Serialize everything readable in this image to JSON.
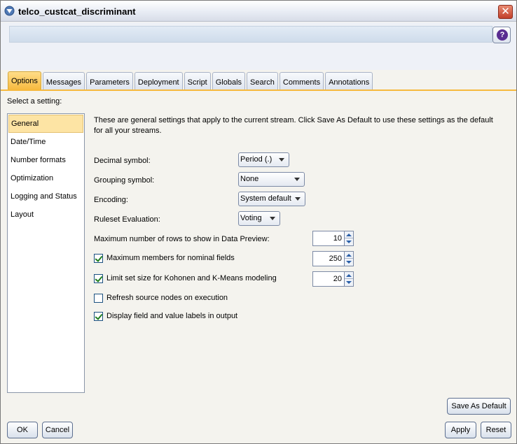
{
  "window": {
    "title": "telco_custcat_discriminant"
  },
  "tabs": [
    {
      "label": "Options",
      "active": true
    },
    {
      "label": "Messages"
    },
    {
      "label": "Parameters"
    },
    {
      "label": "Deployment"
    },
    {
      "label": "Script"
    },
    {
      "label": "Globals"
    },
    {
      "label": "Search"
    },
    {
      "label": "Comments"
    },
    {
      "label": "Annotations"
    }
  ],
  "prompt": "Select a setting:",
  "settings": [
    {
      "label": "General",
      "selected": true
    },
    {
      "label": "Date/Time"
    },
    {
      "label": "Number formats"
    },
    {
      "label": "Optimization"
    },
    {
      "label": "Logging and Status"
    },
    {
      "label": "Layout"
    }
  ],
  "general": {
    "description": "These are general settings that apply to the current stream. Click Save As Default to use these settings as the default for all your streams.",
    "decimal_label": "Decimal symbol:",
    "decimal_value": "Period (.)",
    "grouping_label": "Grouping symbol:",
    "grouping_value": "None",
    "encoding_label": "Encoding:",
    "encoding_value": "System default",
    "ruleset_label": "Ruleset Evaluation:",
    "ruleset_value": "Voting",
    "max_rows_label": "Maximum number of rows to show in Data Preview:",
    "max_rows_value": "10",
    "max_members_label": "Maximum members for nominal fields",
    "max_members_checked": true,
    "max_members_value": "250",
    "limit_set_label": "Limit set size for Kohonen and K-Means modeling",
    "limit_set_checked": true,
    "limit_set_value": "20",
    "refresh_label": "Refresh source nodes on execution",
    "refresh_checked": false,
    "display_labels_label": "Display field and value labels in output",
    "display_labels_checked": true
  },
  "buttons": {
    "save_default": "Save As Default",
    "ok": "OK",
    "cancel": "Cancel",
    "apply": "Apply",
    "reset": "Reset"
  },
  "colors": {
    "active_tab": "#f6b93d",
    "selected_item": "#fde4a4",
    "close_button": "#c2402a",
    "help_icon": "#5a2d91"
  },
  "icons": {
    "title": "stream-icon",
    "close": "close-icon",
    "help": "help-icon"
  }
}
